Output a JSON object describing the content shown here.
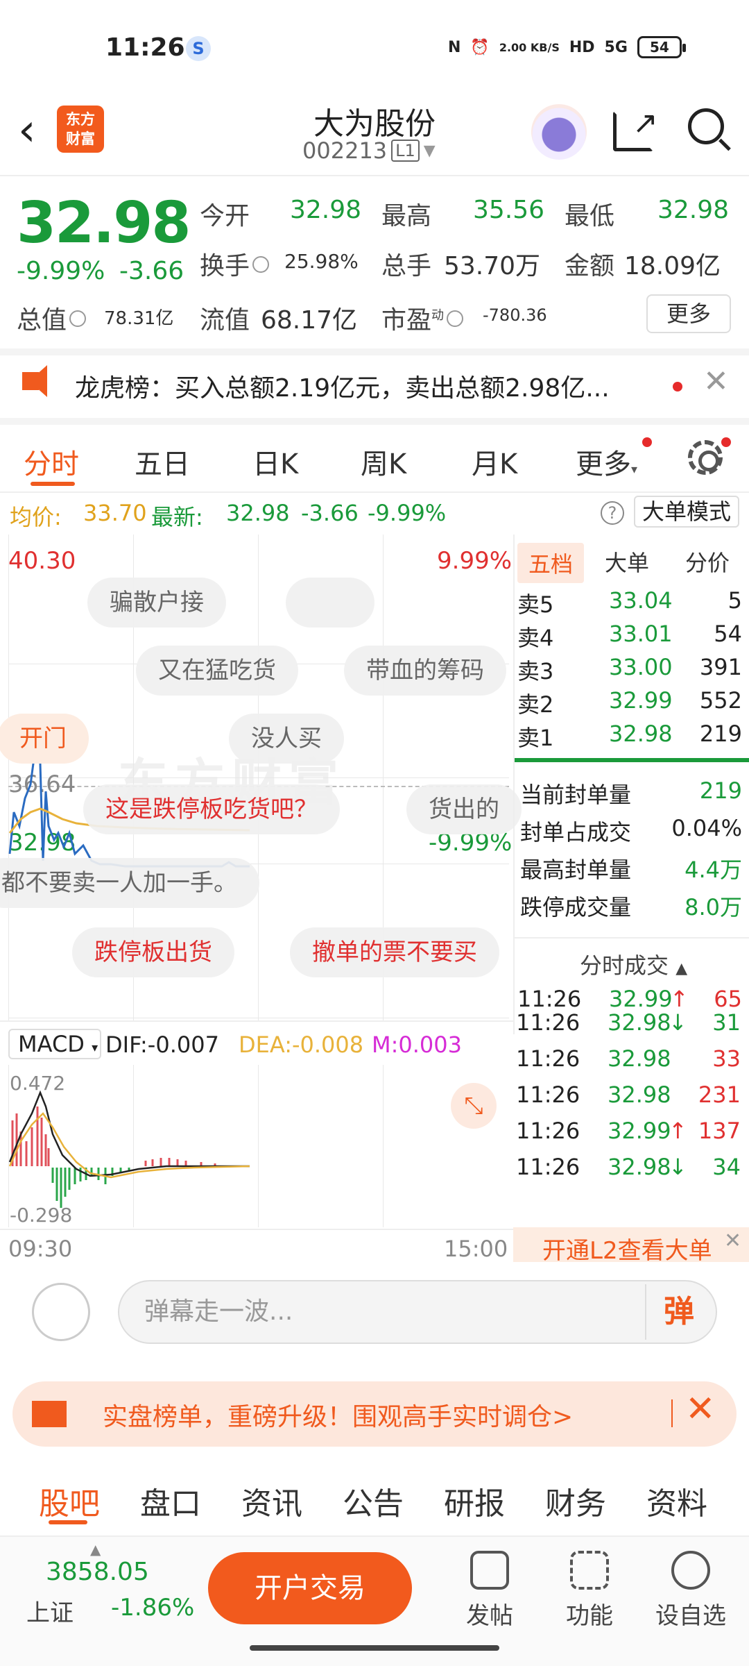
{
  "status": {
    "time": "11:26",
    "speed": "2.00 KB/S",
    "network": "5G",
    "battery": "54"
  },
  "header": {
    "logo": "东方\n财富",
    "name": "大为股份",
    "code": "002213",
    "level": "L1"
  },
  "quote": {
    "price": "32.98",
    "change_pct": "-9.99%",
    "change": "-3.66",
    "open_label": "今开",
    "open": "32.98",
    "high_label": "最高",
    "high": "35.56",
    "low_label": "最低",
    "low": "32.98",
    "turnover_label": "换手",
    "turnover": "25.98%",
    "volume_label": "总手",
    "volume": "53.70万",
    "amount_label": "金额",
    "amount": "18.09亿",
    "mcap_label": "总值",
    "mcap": "78.31亿",
    "float_label": "流值",
    "float": "68.17亿",
    "pe_label": "市盈",
    "pe_sup": "动",
    "pe": "-780.36",
    "more": "更多"
  },
  "banner": {
    "text": "龙虎榜：买入总额2.19亿元，卖出总额2.98亿..."
  },
  "tabs": [
    "分时",
    "五日",
    "日K",
    "周K",
    "月K",
    "更多"
  ],
  "avg": {
    "avg_label": "均价:",
    "avg": "33.70",
    "last_label": "最新:",
    "last": "32.98",
    "chg": "-3.66",
    "pct": "-9.99%",
    "mode": "大单模式",
    "help": "?"
  },
  "chart": {
    "top_price": "40.30",
    "top_pct": "9.99%",
    "mid_price": "36.64",
    "bottom_price": "32.98",
    "bottom_pct": "-9.99%",
    "watermark": "东方财富",
    "time_start": "09:30",
    "time_end": "15:00",
    "macd": {
      "label": "MACD",
      "dif": "DIF:-0.007",
      "dea": "DEA:-0.008",
      "m": "M:0.003",
      "top": "0.472",
      "bottom": "-0.298"
    }
  },
  "danmaku": [
    "骗散户接",
    "又在猛吃货",
    "带血的筹码",
    "开门",
    "没人买",
    "这是跌停板吃货吧？",
    "货出的",
    "都不要卖一人加一手。",
    "跌停板出货",
    "撤单的票不要买"
  ],
  "book": {
    "tabs": [
      "五档",
      "大单",
      "分价"
    ],
    "asks": [
      {
        "label": "卖5",
        "price": "33.04",
        "vol": "5"
      },
      {
        "label": "卖4",
        "price": "33.01",
        "vol": "54"
      },
      {
        "label": "卖3",
        "price": "33.00",
        "vol": "391"
      },
      {
        "label": "卖2",
        "price": "32.99",
        "vol": "552"
      },
      {
        "label": "卖1",
        "price": "32.98",
        "vol": "219"
      }
    ],
    "stats": [
      {
        "label": "当前封单量",
        "value": "219"
      },
      {
        "label": "封单占成交",
        "value": "0.04%"
      },
      {
        "label": "最高封单量",
        "value": "4.4万"
      },
      {
        "label": "跌停成交量",
        "value": "8.0万"
      }
    ],
    "trades_title": "分时成交",
    "trades": [
      {
        "time": "11:26",
        "price": "32.99",
        "dir": "↑",
        "vol": "65"
      },
      {
        "time": "11:26",
        "price": "32.98",
        "dir": "↓",
        "vol": "31"
      },
      {
        "time": "11:26",
        "price": "32.98",
        "dir": "",
        "vol": "33"
      },
      {
        "time": "11:26",
        "price": "32.98",
        "dir": "",
        "vol": "231"
      },
      {
        "time": "11:26",
        "price": "32.99",
        "dir": "↑",
        "vol": "137"
      },
      {
        "time": "11:26",
        "price": "32.98",
        "dir": "↓",
        "vol": "34"
      }
    ],
    "l2": "开通L2查看大单"
  },
  "input": {
    "placeholder": "弹幕走一波...",
    "button": "弹"
  },
  "promo": {
    "text": "实盘榜单，重磅升级！围观高手实时调仓>"
  },
  "subtabs": [
    "股吧",
    "盘口",
    "资讯",
    "公告",
    "研报",
    "财务",
    "资料"
  ],
  "footer": {
    "index_value": "3858.05",
    "index_name": "上证",
    "index_chg": "-1.86%",
    "trade": "开户交易",
    "buttons": [
      "发帖",
      "功能",
      "设自选"
    ]
  },
  "colors": {
    "accent": "#f05a1e",
    "down": "#1a9a3a",
    "up": "#e03030"
  }
}
